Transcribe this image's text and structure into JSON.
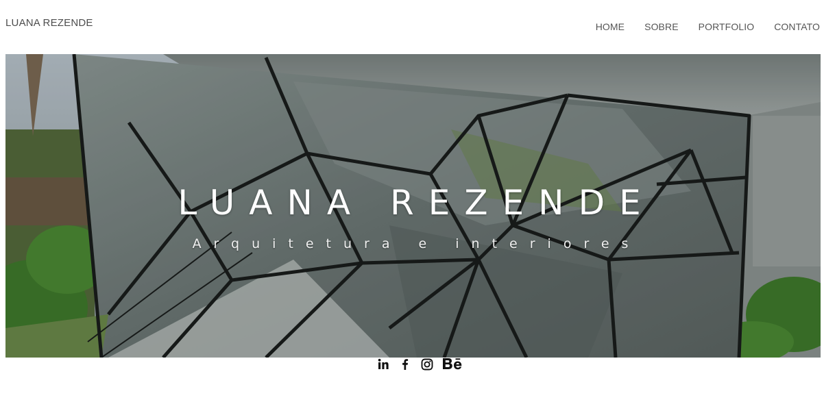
{
  "header": {
    "logo_text": "LUANA REZENDE",
    "nav": [
      {
        "label": "HOME"
      },
      {
        "label": "SOBRE"
      },
      {
        "label": "PORTFOLIO"
      },
      {
        "label": "CONTATO"
      }
    ]
  },
  "hero": {
    "title": "LUANA REZENDE",
    "subtitle": "Arquitetura e interiores"
  },
  "social": {
    "icons": [
      "linkedin-icon",
      "facebook-icon",
      "instagram-icon",
      "behance-icon"
    ],
    "color": "#111111"
  }
}
